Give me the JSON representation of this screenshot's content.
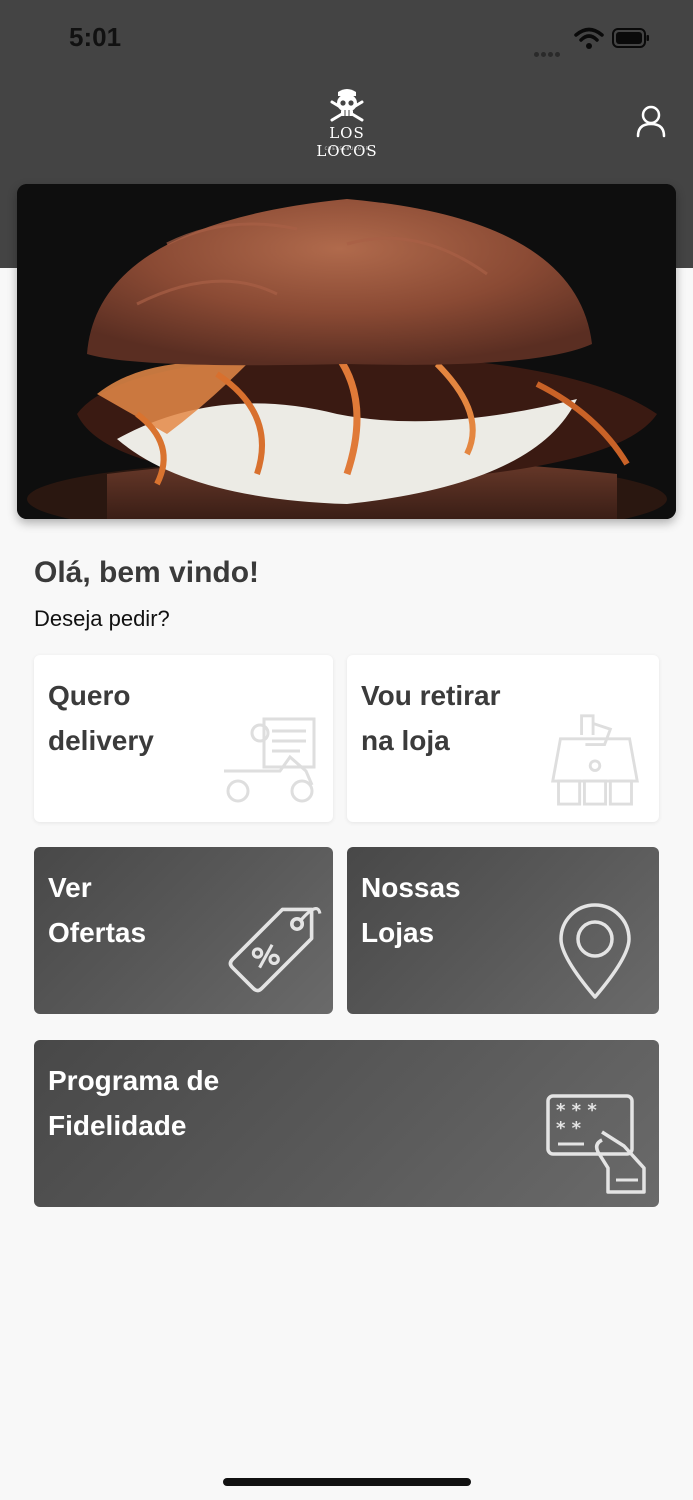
{
  "status_bar": {
    "time": "5:01"
  },
  "brand": {
    "name": "LOS LOCOS",
    "tagline": "CHEESEBURGER"
  },
  "welcome": {
    "title": "Olá, bem vindo!",
    "subtitle": "Deseja pedir?"
  },
  "options": [
    {
      "line1": "Quero",
      "line2": "delivery",
      "icon": "delivery-scooter-icon"
    },
    {
      "line1": "Vou retirar",
      "line2": "na loja",
      "icon": "store-pickup-icon"
    },
    {
      "line1": "Ver",
      "line2": "Ofertas",
      "icon": "discount-tag-icon"
    },
    {
      "line1": "Nossas",
      "line2": "Lojas",
      "icon": "map-pin-icon"
    },
    {
      "line1": "Programa de",
      "line2": "Fidelidade",
      "icon": "loyalty-card-icon"
    }
  ],
  "colors": {
    "header": "#444444",
    "background": "#f8f8f8",
    "card_dark": "#555555",
    "card_light": "#ffffff"
  }
}
